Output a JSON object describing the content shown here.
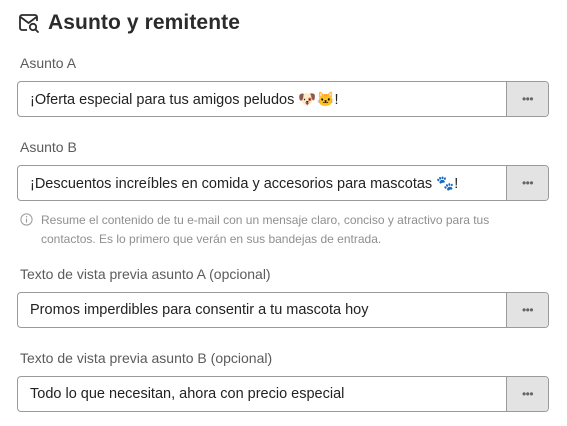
{
  "header": {
    "title": "Asunto y remitente",
    "icon": "mail-search-icon"
  },
  "fields": [
    {
      "label": "Asunto A",
      "value": "¡Oferta especial para tus amigos peludos 🐶🐱!",
      "more": "•••"
    },
    {
      "label": "Asunto B",
      "value": "¡Descuentos increíbles en comida y accesorios para mascotas 🐾!",
      "more": "•••"
    },
    {
      "label": "Texto de vista previa asunto A (opcional)",
      "value": "Promos imperdibles para consentir a tu mascota hoy",
      "more": "•••"
    },
    {
      "label": "Texto de vista previa asunto B (opcional)",
      "value": "Todo lo que necesitan, ahora con precio especial",
      "more": "•••"
    }
  ],
  "hint": {
    "icon": "info-icon",
    "text": "Resume el contenido de tu e-mail con un mensaje claro, conciso y atractivo para tus contactos. Es lo primero que verán en sus bandejas de entrada."
  }
}
